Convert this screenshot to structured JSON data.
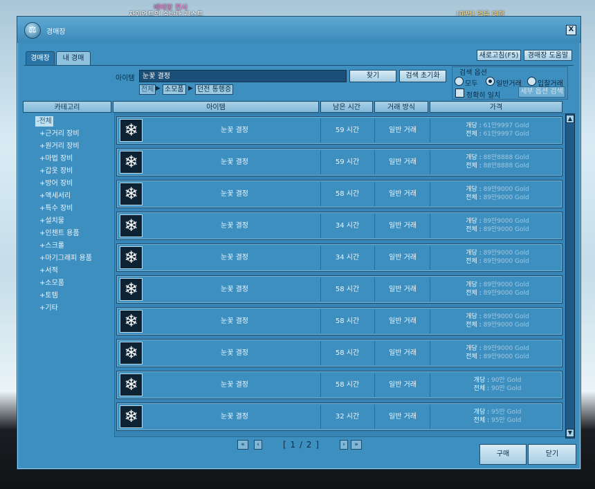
{
  "background": {
    "top_left_text": "베테랑 전사",
    "top_left_text2": "자이언트의 숨바깨 퀘스트",
    "top_right_text": "[마법] 얼음 여행"
  },
  "window": {
    "title": "경매장",
    "close_label": "X",
    "tabs": [
      {
        "label": "경매장",
        "active": true
      },
      {
        "label": "내 경매",
        "active": false
      }
    ],
    "refresh_label": "새로고침(F5)",
    "help_label": "경매장 도움말"
  },
  "search": {
    "item_label": "아이템",
    "item_value": "눈꽃 결정",
    "find_label": "찾기",
    "reset_label": "검색 초기화",
    "breadcrumb": [
      "전체",
      "소모품",
      "던전 통행증"
    ],
    "options_title": "검색 옵션",
    "radio_all": "모두",
    "radio_normal": "일반거래",
    "radio_bid": "입찰거래",
    "selected_option": "일반거래",
    "exact_label": "정확히 일치",
    "exact_checked": false,
    "detail_label": "세부 옵션 검색"
  },
  "headers": {
    "category": "카테고리",
    "item": "아이템",
    "time": "남은 시간",
    "type": "거래 방식",
    "price": "가격"
  },
  "categories": [
    "-전체",
    "+근거리 장비",
    "+원거리 장비",
    "+마법 장비",
    "+갑옷 장비",
    "+방어 장비",
    "+액세서리",
    "+특수 장비",
    "+설치물",
    "+인챈트 용품",
    "+스크롤",
    "+마기그래피 용품",
    "+서적",
    "+소모품",
    "+토템",
    "+기타"
  ],
  "selected_category": "-전체",
  "items": [
    {
      "name": "눈꽃 결정",
      "time": "59 시간",
      "type": "일반 거래",
      "unit_label": "개당 :",
      "unit_price": "61만9997 Gold",
      "total_label": "전체 :",
      "total_price": "61만9997 Gold"
    },
    {
      "name": "눈꽃 결정",
      "time": "59 시간",
      "type": "일반 거래",
      "unit_label": "개당 :",
      "unit_price": "88만8888 Gold",
      "total_label": "전체 :",
      "total_price": "88만8888 Gold"
    },
    {
      "name": "눈꽃 결정",
      "time": "58 시간",
      "type": "일반 거래",
      "unit_label": "개당 :",
      "unit_price": "89만9000 Gold",
      "total_label": "전체 :",
      "total_price": "89만9000 Gold"
    },
    {
      "name": "눈꽃 결정",
      "time": "34 시간",
      "type": "일반 거래",
      "unit_label": "개당 :",
      "unit_price": "89만9000 Gold",
      "total_label": "전체 :",
      "total_price": "89만9000 Gold"
    },
    {
      "name": "눈꽃 결정",
      "time": "34 시간",
      "type": "일반 거래",
      "unit_label": "개당 :",
      "unit_price": "89만9000 Gold",
      "total_label": "전체 :",
      "total_price": "89만9000 Gold"
    },
    {
      "name": "눈꽃 결정",
      "time": "58 시간",
      "type": "일반 거래",
      "unit_label": "개당 :",
      "unit_price": "89만9000 Gold",
      "total_label": "전체 :",
      "total_price": "89만9000 Gold"
    },
    {
      "name": "눈꽃 결정",
      "time": "58 시간",
      "type": "일반 거래",
      "unit_label": "개당 :",
      "unit_price": "89만9000 Gold",
      "total_label": "전체 :",
      "total_price": "89만9000 Gold"
    },
    {
      "name": "눈꽃 결정",
      "time": "58 시간",
      "type": "일반 거래",
      "unit_label": "개당 :",
      "unit_price": "89만9000 Gold",
      "total_label": "전체 :",
      "total_price": "89만9000 Gold"
    },
    {
      "name": "눈꽃 결정",
      "time": "58 시간",
      "type": "일반 거래",
      "unit_label": "개당 :",
      "unit_price": "90만 Gold",
      "total_label": "전체 :",
      "total_price": "90만 Gold"
    },
    {
      "name": "눈꽃 결정",
      "time": "32 시간",
      "type": "일반 거래",
      "unit_label": "개당 :",
      "unit_price": "95만 Gold",
      "total_label": "전체 :",
      "total_price": "95만 Gold"
    }
  ],
  "pagination": {
    "first": "«",
    "prev": "‹",
    "page_text": "[ 1 / 2 ]",
    "next": "›",
    "last": "»"
  },
  "footer": {
    "buy_label": "구매",
    "close_label": "닫기"
  },
  "icons": {
    "logo": "scales-icon",
    "item": "snowflake-icon"
  }
}
